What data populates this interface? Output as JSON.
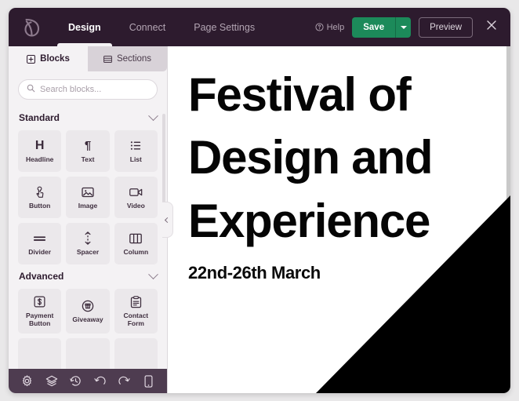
{
  "header": {
    "logo_icon": "leaf-logo-icon",
    "nav": [
      {
        "label": "Design",
        "active": true
      },
      {
        "label": "Connect",
        "active": false
      },
      {
        "label": "Page Settings",
        "active": false
      }
    ],
    "help_label": "Help",
    "help_icon": "question-circle-icon",
    "save_label": "Save",
    "save_caret_icon": "chevron-down-icon",
    "preview_label": "Preview",
    "close_icon": "close-icon",
    "colors": {
      "bar": "#2d1b2e",
      "save_green": "#1c8a5a",
      "nav_inactive": "#b3a5b3"
    }
  },
  "sidebar": {
    "tabs": [
      {
        "label": "Blocks",
        "icon": "blocks-grid-icon",
        "active": true
      },
      {
        "label": "Sections",
        "icon": "sections-layout-icon",
        "active": false
      }
    ],
    "search": {
      "placeholder": "Search blocks...",
      "value": "",
      "icon": "search-icon"
    },
    "groups": [
      {
        "title": "Standard",
        "chevron_icon": "chevron-down-icon",
        "blocks": [
          {
            "label": "Headline",
            "icon": "headline-h-icon"
          },
          {
            "label": "Text",
            "icon": "paragraph-pilcrow-icon"
          },
          {
            "label": "List",
            "icon": "list-icon"
          },
          {
            "label": "Button",
            "icon": "pointer-click-icon"
          },
          {
            "label": "Image",
            "icon": "image-icon"
          },
          {
            "label": "Video",
            "icon": "video-camera-icon"
          },
          {
            "label": "Divider",
            "icon": "divider-equals-icon"
          },
          {
            "label": "Spacer",
            "icon": "vertical-arrows-icon"
          },
          {
            "label": "Column",
            "icon": "columns-icon"
          }
        ]
      },
      {
        "title": "Advanced",
        "chevron_icon": "chevron-down-icon",
        "blocks": [
          {
            "label": "Payment Button",
            "icon": "dollar-square-icon"
          },
          {
            "label": "Giveaway",
            "icon": "giveaway-badge-icon"
          },
          {
            "label": "Contact Form",
            "icon": "contact-form-icon"
          }
        ]
      }
    ],
    "toolbar": [
      {
        "icon": "gear-icon",
        "name": "settings-button"
      },
      {
        "icon": "layers-icon",
        "name": "layers-button"
      },
      {
        "icon": "history-clock-icon",
        "name": "history-button"
      },
      {
        "icon": "undo-arrow-icon",
        "name": "undo-button"
      },
      {
        "icon": "redo-arrow-icon",
        "name": "redo-button"
      },
      {
        "icon": "mobile-device-icon",
        "name": "device-preview-button"
      }
    ],
    "collapse_icon": "chevron-left-icon"
  },
  "canvas": {
    "hero_title": "Festival of Design and Experience",
    "hero_subtitle": "22nd-26th March",
    "decor_shape": "black-triangle"
  }
}
